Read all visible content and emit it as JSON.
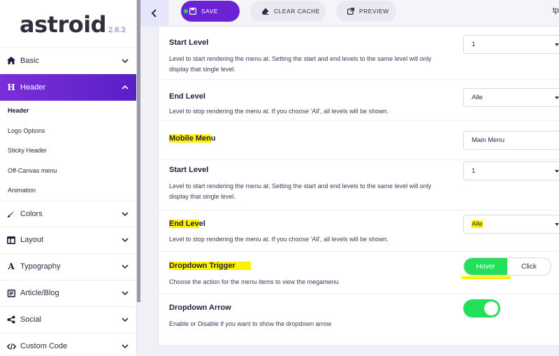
{
  "sidebar": {
    "logo": "astroid",
    "version": "2.6.3",
    "items": [
      {
        "label": "Basic",
        "icon": "home-icon"
      },
      {
        "label": "Header",
        "icon": "heading-icon"
      },
      {
        "label": "Colors",
        "icon": "brush-icon"
      },
      {
        "label": "Layout",
        "icon": "layout-icon"
      },
      {
        "label": "Typography",
        "icon": "font-icon"
      },
      {
        "label": "Article/Blog",
        "icon": "article-icon"
      },
      {
        "label": "Social",
        "icon": "share-icon"
      },
      {
        "label": "Custom Code",
        "icon": "code-icon"
      }
    ],
    "header_sub": [
      "Header",
      "Logo Options",
      "Sticky Header",
      "Off-Canvas menu",
      "Animation"
    ]
  },
  "topbar": {
    "save": "Save",
    "clear_cache": "Clear Cache",
    "preview": "Preview",
    "user": "tp"
  },
  "fields": {
    "start_level": {
      "label": "Start Level",
      "desc": "Level to start rendering the menu at. Setting the start and end levels to the same level will only display that single level.",
      "value": "1"
    },
    "end_level": {
      "label": "End Level",
      "desc": "Level to stop rendering the menu at. If you choose 'All', all levels will be shown.",
      "value": "Alle"
    },
    "mobile_menu": {
      "label_hl": "Mobile Men",
      "label_rest": "u",
      "value": "Main Menu"
    },
    "mobile_start_level": {
      "label": "Start Level",
      "desc": "Level to start rendering the menu at. Setting the start and end levels to the same level will only display that single level.",
      "value": "1"
    },
    "mobile_end_level": {
      "label_hl": "End Lev",
      "label_rest": "el",
      "desc": "Level to stop rendering the menu at. If you choose 'All', all levels will be shown.",
      "value": "Alle"
    },
    "dropdown_trigger": {
      "label": "Dropdown Trigger",
      "desc": "Choose the action for the menu items to view the megamenu",
      "options": [
        "Hover",
        "Click"
      ],
      "selected": "Hover"
    },
    "dropdown_arrow": {
      "label": "Dropdown Arrow",
      "desc": "Enable or Disable if you want to show the dropdown arrow",
      "enabled": true
    }
  },
  "colors": {
    "accent": "#6a22d4",
    "toggle_on": "#23e05a",
    "highlight": "#fff200"
  }
}
